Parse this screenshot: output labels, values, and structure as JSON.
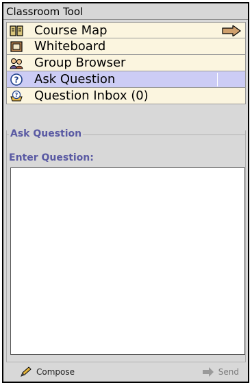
{
  "window": {
    "title": "Classroom Tool"
  },
  "menu": {
    "items": [
      {
        "label": "Course Map",
        "icon": "book-icon"
      },
      {
        "label": "Whiteboard",
        "icon": "whiteboard-icon"
      },
      {
        "label": "Group Browser",
        "icon": "group-icon"
      },
      {
        "label": "Ask Question",
        "icon": "question-icon",
        "selected": true
      },
      {
        "label": "Question Inbox (0)",
        "icon": "inbox-icon"
      }
    ]
  },
  "ask_question": {
    "group_title": "Ask Question",
    "field_label": "Enter Question:",
    "question_text": "",
    "compose_label": "Compose",
    "send_label": "Send"
  },
  "colors": {
    "menu_bg": "#fbf5df",
    "menu_selected_bg": "#ccccf5",
    "group_text": "#5a5aa3",
    "panel_bg": "#d8d8d8"
  }
}
